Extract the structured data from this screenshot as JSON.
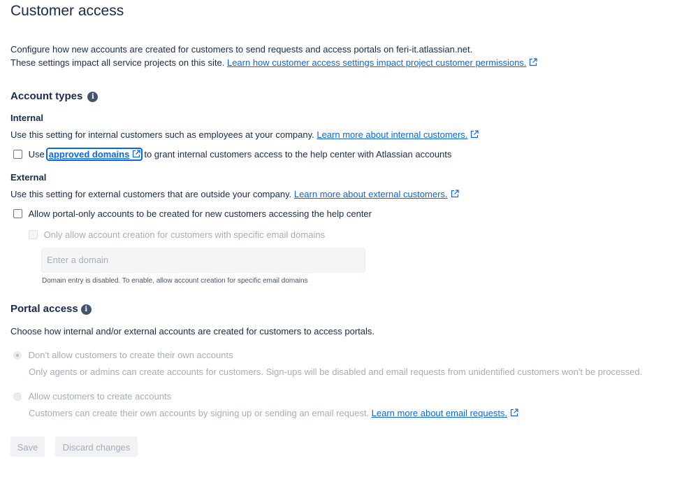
{
  "page_title": "Customer access",
  "intro": {
    "line1": "Configure how new accounts are created for customers to send requests and access portals on feri-it.atlassian.net.",
    "line2_prefix": "These settings impact all service projects on this site. ",
    "line2_link": "Learn how customer access settings impact project customer permissions."
  },
  "account_types": {
    "title": "Account types",
    "internal": {
      "title": "Internal",
      "description": "Use this setting for internal customers such as employees at your company. ",
      "link": "Learn more about internal customers.",
      "checkbox_prefix": "Use",
      "checkbox_link": "approved domains",
      "checkbox_suffix": "to grant internal customers access to the help center with Atlassian accounts"
    },
    "external": {
      "title": "External",
      "description": "Use this setting for external customers that are outside your company. ",
      "link": "Learn more about external customers.",
      "checkbox_label": "Allow portal-only accounts to be created for new customers accessing the help center",
      "sub_checkbox_label": "Only allow account creation for customers with specific email domains",
      "domain_placeholder": "Enter a domain",
      "domain_helper": "Domain entry is disabled. To enable, allow account creation for specific email domains"
    }
  },
  "portal_access": {
    "title": "Portal access",
    "description": "Choose how internal and/or external accounts are created for customers to access portals.",
    "options": [
      {
        "label": "Don't allow customers to create their own accounts",
        "description": "Only agents or admins can create accounts for customers. Sign-ups will be disabled and email requests from unidentified customers won't be processed.",
        "checked": true
      },
      {
        "label": "Allow customers to create accounts",
        "description": "Customers can create their own accounts by signing up or sending an email request. ",
        "link": "Learn more about email requests.",
        "checked": false
      }
    ]
  },
  "buttons": {
    "save": "Save",
    "discard": "Discard changes"
  },
  "colors": {
    "link": "#0c66e4",
    "text": "#172b4d",
    "disabled": "#a5adba"
  }
}
